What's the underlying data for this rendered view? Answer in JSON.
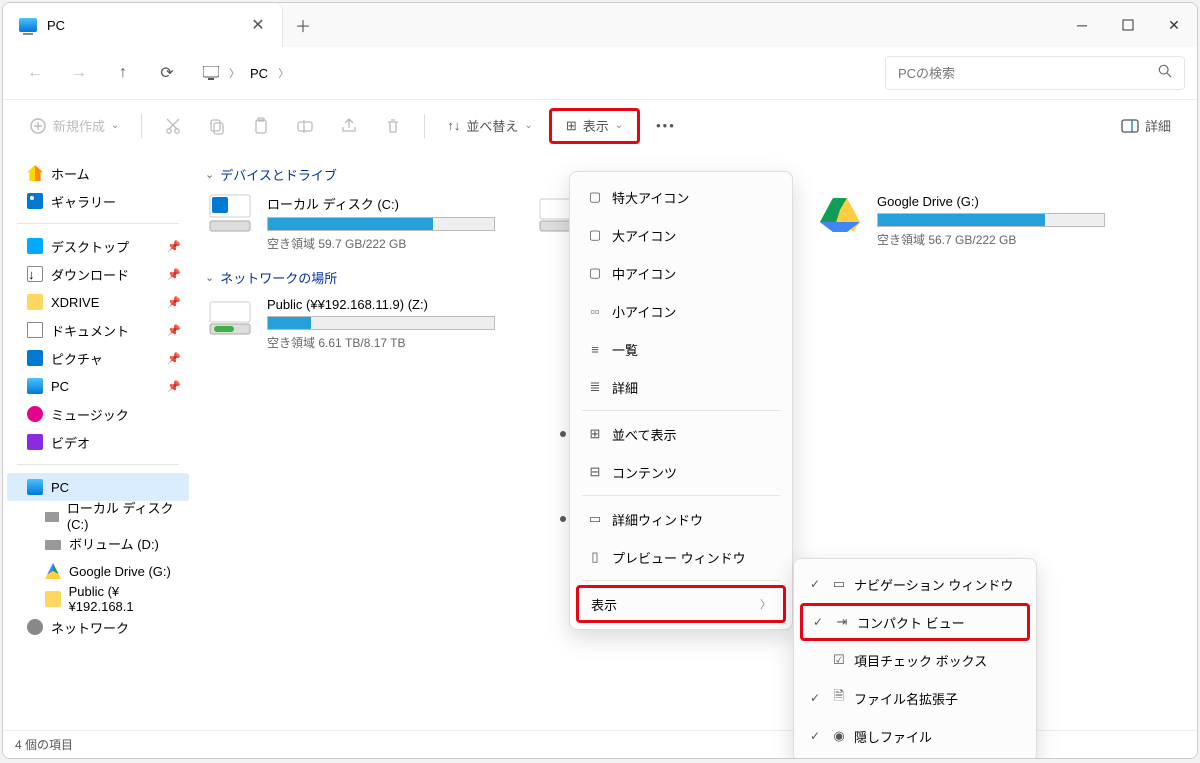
{
  "tab": {
    "title": "PC"
  },
  "window_controls": {
    "min": "−",
    "max": "□",
    "close": "✕"
  },
  "nav": {
    "back": "←",
    "forward": "→",
    "up": "↑",
    "refresh": "⟳"
  },
  "breadcrumb": {
    "root_icon": "pc",
    "items": [
      "PC"
    ]
  },
  "search": {
    "placeholder": "PCの検索"
  },
  "toolbar": {
    "new": "新規作成",
    "sort": "並べ替え",
    "view": "表示",
    "details_pane": "詳細"
  },
  "sidebar": {
    "top": [
      {
        "icon": "home",
        "label": "ホーム"
      },
      {
        "icon": "gallery",
        "label": "ギャラリー"
      }
    ],
    "quick": [
      {
        "icon": "desktop",
        "label": "デスクトップ",
        "pinned": true
      },
      {
        "icon": "download",
        "label": "ダウンロード",
        "pinned": true
      },
      {
        "icon": "folder",
        "label": "XDRIVE",
        "pinned": true
      },
      {
        "icon": "doc",
        "label": "ドキュメント",
        "pinned": true
      },
      {
        "icon": "pic",
        "label": "ピクチャ",
        "pinned": true
      },
      {
        "icon": "pc2",
        "label": "PC",
        "pinned": true
      },
      {
        "icon": "music",
        "label": "ミュージック"
      },
      {
        "icon": "video",
        "label": "ビデオ"
      }
    ],
    "pc": {
      "label": "PC",
      "children": [
        {
          "icon": "disk",
          "label": "ローカル ディスク (C:)"
        },
        {
          "icon": "disk",
          "label": "ボリューム (D:)"
        },
        {
          "icon": "gdrive",
          "label": "Google Drive (G:)"
        },
        {
          "icon": "folder",
          "label": "Public (¥¥192.168.1"
        }
      ]
    },
    "network": {
      "icon": "net",
      "label": "ネットワーク"
    }
  },
  "content": {
    "group1": {
      "title": "デバイスとドライブ",
      "drives": [
        {
          "name": "ローカル ディスク (C:)",
          "free": "空き領域 59.7 GB/222 GB",
          "fill": 73,
          "icon": "cdrive"
        },
        {
          "name": "",
          "free": "",
          "fill": 0,
          "icon": "disk-plain"
        },
        {
          "name": "Google Drive (G:)",
          "free": "空き領域 56.7 GB/222 GB",
          "fill": 74,
          "icon": "gdrive"
        }
      ]
    },
    "group2": {
      "title": "ネットワークの場所",
      "drives": [
        {
          "name": "Public (¥¥192.168.11.9) (Z:)",
          "free": "空き領域 6.61 TB/8.17 TB",
          "fill": 19,
          "icon": "netdrive"
        }
      ]
    }
  },
  "menu_view": {
    "items": [
      {
        "icon": "□",
        "label": "特大アイコン"
      },
      {
        "icon": "□",
        "label": "大アイコン"
      },
      {
        "icon": "□",
        "label": "中アイコン"
      },
      {
        "icon": "▫▫",
        "label": "小アイコン"
      },
      {
        "icon": "≡",
        "label": "一覧"
      },
      {
        "icon": "≣",
        "label": "詳細"
      }
    ],
    "items2": [
      {
        "icon": "⊞",
        "label": "並べて表示",
        "dot": true
      },
      {
        "icon": "⊟",
        "label": "コンテンツ"
      }
    ],
    "items3": [
      {
        "icon": "▭",
        "label": "詳細ウィンドウ",
        "dot": true
      },
      {
        "icon": "▯",
        "label": "プレビュー ウィンドウ"
      }
    ],
    "submenu_label": "表示"
  },
  "menu_show": {
    "items": [
      {
        "icon": "▭",
        "label": "ナビゲーション ウィンドウ",
        "check": true
      },
      {
        "icon": "⇥",
        "label": "コンパクト ビュー",
        "check": true,
        "highlight": true
      },
      {
        "icon": "☑",
        "label": "項目チェック ボックス"
      },
      {
        "icon": "🗎",
        "label": "ファイル名拡張子",
        "check": true
      },
      {
        "icon": "◉",
        "label": "隠しファイル",
        "check": true
      }
    ]
  },
  "status": {
    "text": "4 個の項目"
  }
}
